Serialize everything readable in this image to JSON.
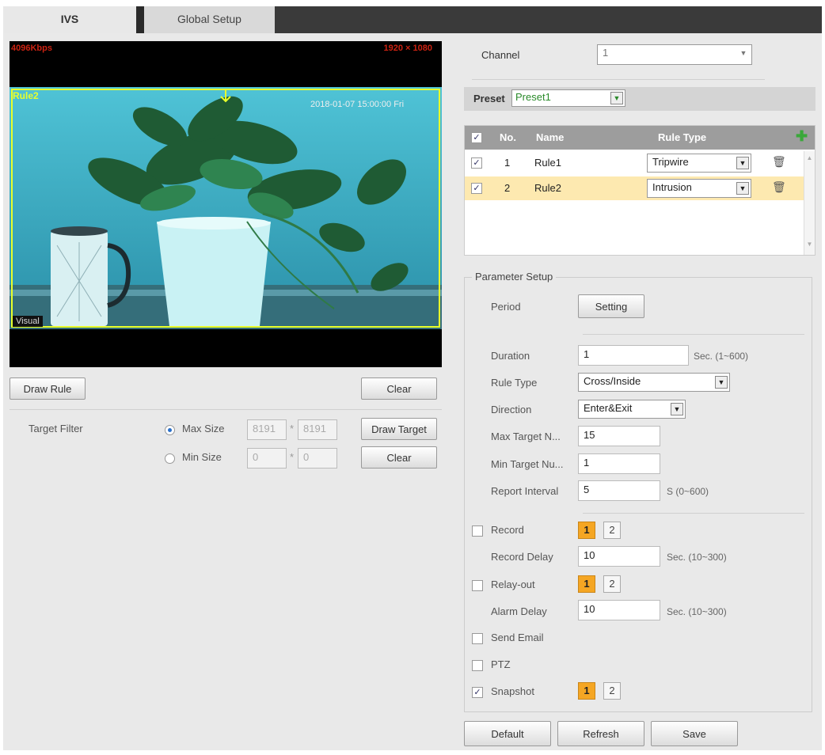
{
  "tabs": [
    {
      "label": "IVS",
      "active": true
    },
    {
      "label": "Global Setup",
      "active": false
    }
  ],
  "video": {
    "top_left": "4096Kbps",
    "top_right": "1920 × 1080",
    "rule_label": "Rule2",
    "timestamp": "2018-01-07 15:00:00 Fri",
    "visual_label": "Visual"
  },
  "left": {
    "draw_rule": "Draw Rule",
    "clear_top": "Clear",
    "target_filter": "Target Filter",
    "max_size_label": "Max Size",
    "min_size_label": "Min Size",
    "max_w": "8191",
    "max_h": "8191",
    "min_w": "0",
    "min_h": "0",
    "separator": "*",
    "draw_target": "Draw Target",
    "clear_bottom": "Clear"
  },
  "right": {
    "channel_label": "Channel",
    "channel_value": "1",
    "preset_label": "Preset",
    "preset_value": "Preset1",
    "table": {
      "headers": {
        "no": "No.",
        "name": "Name",
        "rule_type": "Rule Type"
      },
      "rows": [
        {
          "no": "1",
          "name": "Rule1",
          "type": "Tripwire",
          "checked": true,
          "selected": false
        },
        {
          "no": "2",
          "name": "Rule2",
          "type": "Intrusion",
          "checked": true,
          "selected": true
        }
      ]
    },
    "param_setup": {
      "legend": "Parameter Setup",
      "period_label": "Period",
      "setting_btn": "Setting",
      "duration_label": "Duration",
      "duration_value": "1",
      "duration_hint": "Sec. (1~600)",
      "rule_type_label": "Rule Type",
      "rule_type_value": "Cross/Inside",
      "direction_label": "Direction",
      "direction_value": "Enter&Exit",
      "max_target_label": "Max Target N...",
      "max_target_value": "15",
      "min_target_label": "Min Target Nu...",
      "min_target_value": "1",
      "report_interval_label": "Report Interval",
      "report_interval_value": "5",
      "report_interval_hint": "S (0~600)",
      "record_label": "Record",
      "record_delay_label": "Record Delay",
      "record_delay_value": "10",
      "record_delay_hint": "Sec. (10~300)",
      "relay_label": "Relay-out",
      "alarm_delay_label": "Alarm Delay",
      "alarm_delay_value": "10",
      "alarm_delay_hint": "Sec. (10~300)",
      "send_email_label": "Send Email",
      "ptz_label": "PTZ",
      "snapshot_label": "Snapshot",
      "num1": "1",
      "num2": "2"
    },
    "buttons": {
      "default": "Default",
      "refresh": "Refresh",
      "save": "Save"
    }
  },
  "colors": {
    "accent_orange": "#f5a623",
    "selected_row": "#fde9b0",
    "rule_yellow": "#e8ff2a",
    "add_green": "#3aa83a"
  },
  "icons": [
    "plus-icon",
    "trash-icon",
    "chevron-down-icon",
    "checkbox-icon",
    "radio-icon"
  ]
}
